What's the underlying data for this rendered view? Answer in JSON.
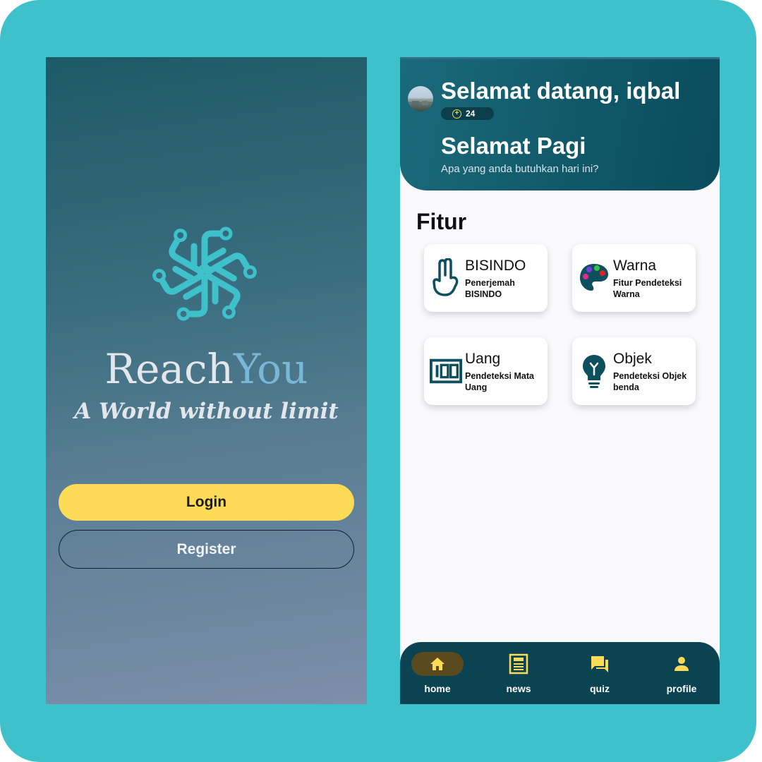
{
  "splash": {
    "brand_part1": "Reach",
    "brand_part2": "You",
    "tagline": "A World without limit",
    "login_label": "Login",
    "register_label": "Register",
    "colors": {
      "login_bg": "#fedb57",
      "brand_accent": "#79b8d4"
    }
  },
  "home": {
    "welcome": "Selamat datang, iqbal",
    "points": "24",
    "greeting": "Selamat Pagi",
    "subgreeting": "Apa yang anda butuhkan hari ini?",
    "section_title": "Fitur",
    "features": [
      {
        "title": "BISINDO",
        "desc": "Penerjemah BISINDO",
        "icon": "hand-sign-icon"
      },
      {
        "title": "Warna",
        "desc": "Fitur Pendeteksi Warna",
        "icon": "palette-icon"
      },
      {
        "title": "Uang",
        "desc": "Pendeteksi Mata Uang",
        "icon": "money-icon"
      },
      {
        "title": "Objek",
        "desc": "Pendeteksi Objek benda",
        "icon": "lightbulb-icon"
      }
    ],
    "nav": [
      {
        "label": "home",
        "icon": "home-icon",
        "active": true
      },
      {
        "label": "news",
        "icon": "newspaper-icon",
        "active": false
      },
      {
        "label": "quiz",
        "icon": "chat-icon",
        "active": false
      },
      {
        "label": "profile",
        "icon": "person-icon",
        "active": false
      }
    ],
    "colors": {
      "header": "#0f5767",
      "nav_bg": "#0b4352",
      "nav_active": "#5b4a1d",
      "icon_teal": "#0e4f5e"
    }
  }
}
